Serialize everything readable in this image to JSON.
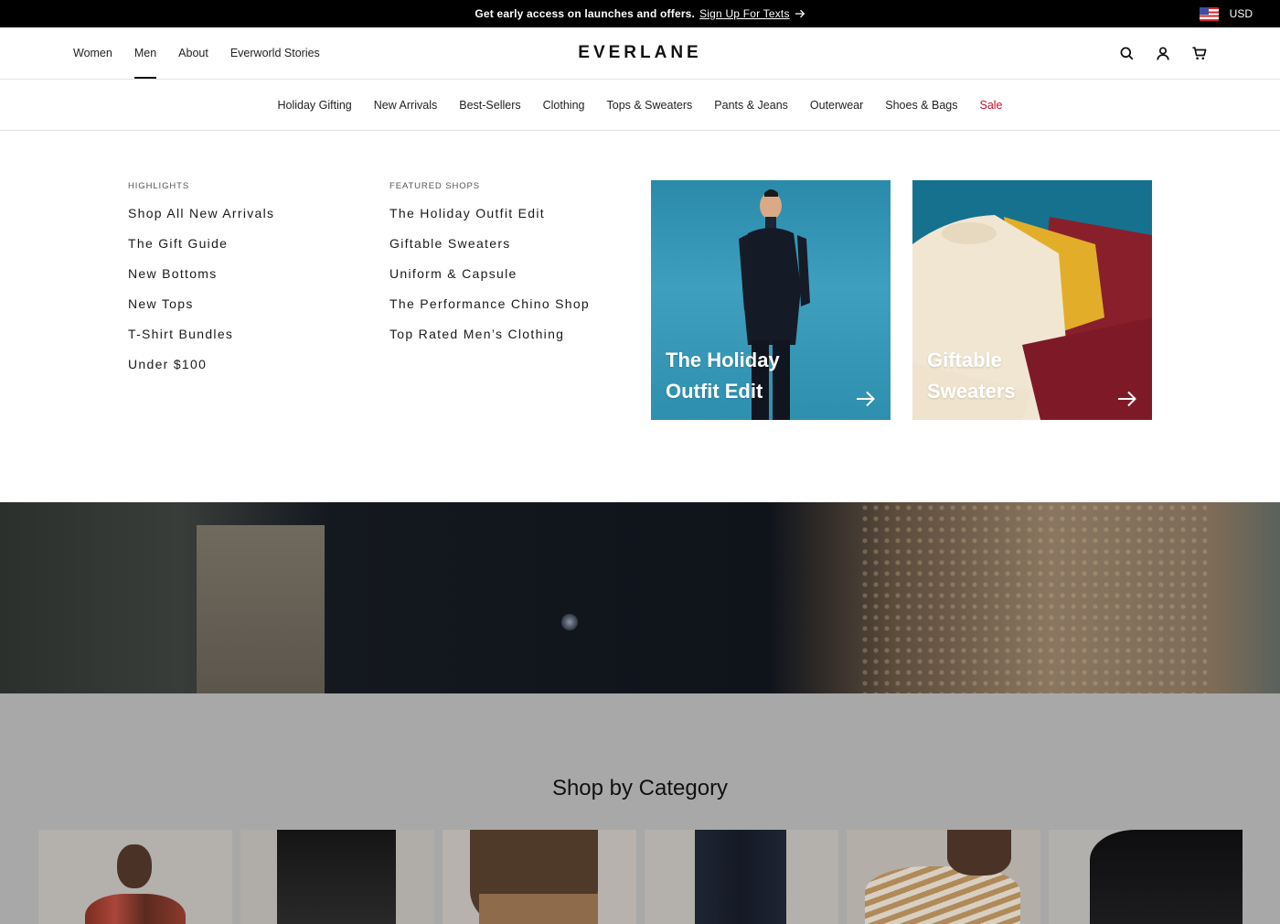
{
  "announcement": {
    "message": "Get early access on launches and offers.",
    "link_label": "Sign Up For Texts",
    "currency": "USD"
  },
  "header": {
    "top_nav": [
      {
        "label": "Women",
        "active": false
      },
      {
        "label": "Men",
        "active": true
      },
      {
        "label": "About",
        "active": false
      },
      {
        "label": "Everworld Stories",
        "active": false
      }
    ],
    "logo": "EVERLANE",
    "icons": [
      "search-icon",
      "account-icon",
      "cart-icon"
    ]
  },
  "category_nav": [
    {
      "label": "Holiday Gifting"
    },
    {
      "label": "New Arrivals"
    },
    {
      "label": "Best-Sellers"
    },
    {
      "label": "Clothing"
    },
    {
      "label": "Tops & Sweaters"
    },
    {
      "label": "Pants & Jeans"
    },
    {
      "label": "Outerwear"
    },
    {
      "label": "Shoes & Bags"
    },
    {
      "label": "Sale",
      "highlight": true,
      "color": "#c8102e"
    }
  ],
  "mega_menu": {
    "highlights": {
      "heading": "HIGHLIGHTS",
      "items": [
        "Shop All New Arrivals",
        "The Gift Guide",
        "New Bottoms",
        "New Tops",
        "T-Shirt Bundles",
        "Under $100"
      ]
    },
    "featured_shops": {
      "heading": "FEATURED SHOPS",
      "items": [
        "The Holiday Outfit Edit",
        "Giftable Sweaters",
        "Uniform & Capsule",
        "The Performance Chino Shop",
        "Top Rated Men’s Clothing"
      ]
    },
    "promos": [
      {
        "title": "The Holiday Outfit Edit"
      },
      {
        "title": "Giftable Sweaters"
      }
    ]
  },
  "category_section": {
    "heading": "Shop by Category"
  },
  "colors": {
    "announcement_bg": "#000000",
    "sale": "#c8102e",
    "overlay": "#a8a8a8"
  }
}
